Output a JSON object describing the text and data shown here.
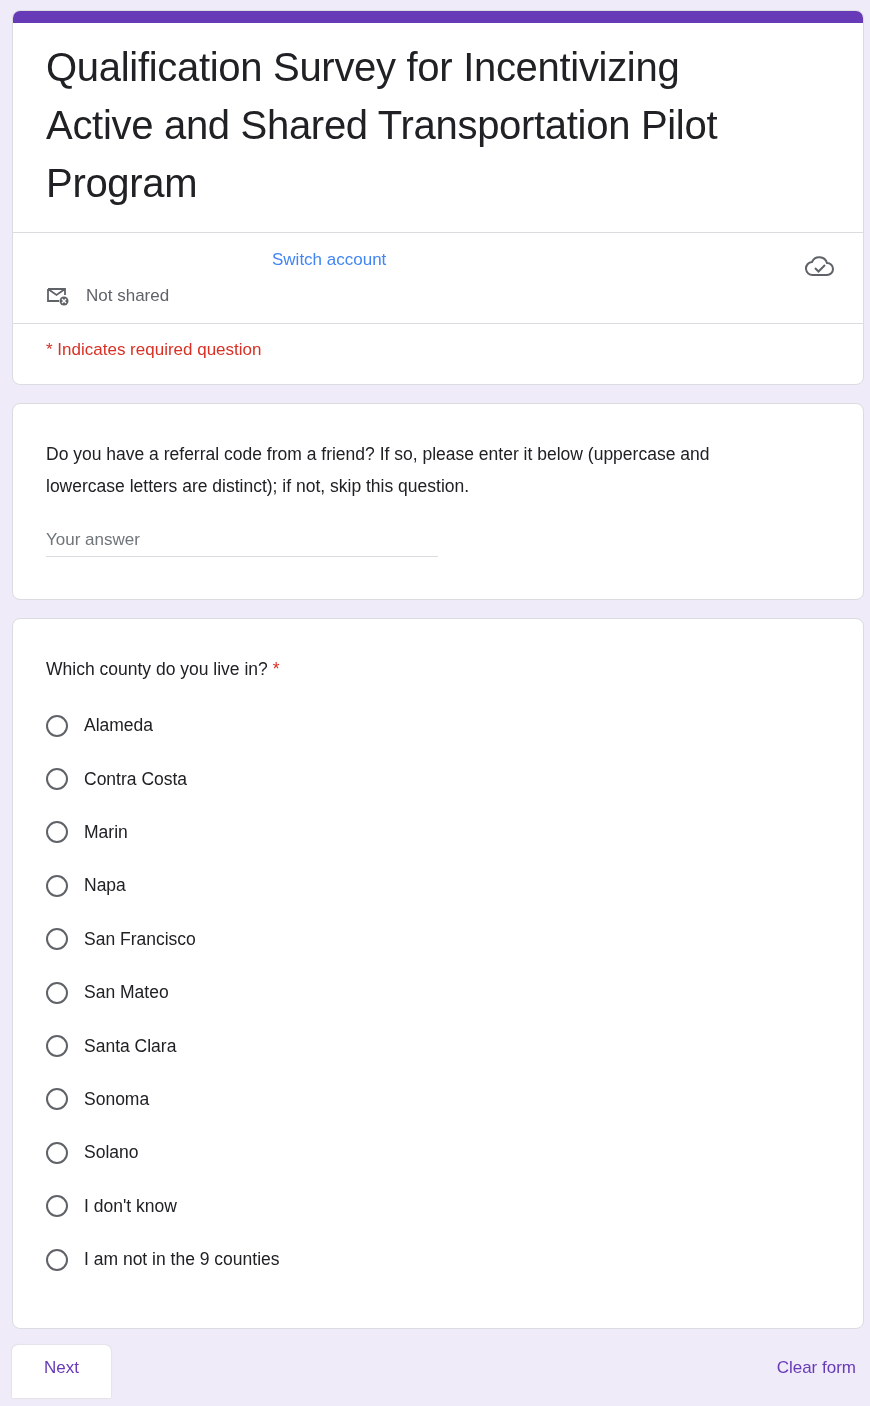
{
  "header": {
    "title": "Qualification Survey for Incentivizing Active and Shared Transportation Pilot Program",
    "switch_account": "Switch account",
    "email_status": "Not shared",
    "required_note": "* Indicates required question"
  },
  "questions": [
    {
      "kind": "text",
      "prompt": "Do you have a referral code from a friend? If so, please enter it below (uppercase and lowercase letters are distinct); if not, skip this question.",
      "required": false,
      "placeholder": "Your answer"
    },
    {
      "kind": "radio",
      "prompt": "Which county do you live in?",
      "required": true,
      "required_mark": "*",
      "options": [
        {
          "label": "Alameda",
          "selected": false
        },
        {
          "label": "Contra Costa",
          "selected": false
        },
        {
          "label": "Marin",
          "selected": false
        },
        {
          "label": "Napa",
          "selected": false
        },
        {
          "label": "San Francisco",
          "selected": false
        },
        {
          "label": "San Mateo",
          "selected": false
        },
        {
          "label": "Santa Clara",
          "selected": false
        },
        {
          "label": "Sonoma",
          "selected": false
        },
        {
          "label": "Solano",
          "selected": false
        },
        {
          "label": "I don't know",
          "selected": false
        },
        {
          "label": "I am not in the 9 counties",
          "selected": false
        }
      ]
    }
  ],
  "footer": {
    "next": "Next",
    "clear": "Clear form"
  }
}
